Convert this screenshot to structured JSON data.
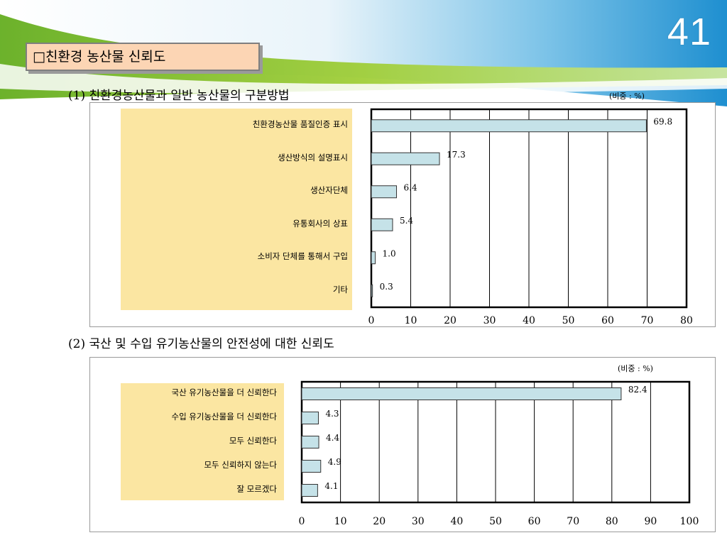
{
  "slide": {
    "number": "41",
    "title": "□친환경 농산물 신뢰도"
  },
  "charts": {
    "chart1": {
      "heading": "(1) 친환경농산물과 일반 농산물의 구분방법",
      "unit": "(비중 : %)"
    },
    "chart2": {
      "heading": "(2) 국산 및 수입 유기농산물의 안전성에 대한 신뢰도",
      "unit": "(비중 : %)"
    }
  },
  "colors": {
    "bar_fill": "#c5e2e8",
    "bar_stroke": "#333333",
    "label_bg": "#fbe6a2",
    "title_bg": "#fcd5b4"
  },
  "chart_data": [
    {
      "type": "bar",
      "orientation": "horizontal",
      "categories": [
        "친환경농산물 품질인증 표시",
        "생산방식의 설명표시",
        "생산자단체",
        "유통회사의 상표",
        "소비자 단체를 통해서 구입",
        "기타"
      ],
      "values": [
        69.8,
        17.3,
        6.4,
        5.4,
        1.0,
        0.3
      ],
      "value_labels": [
        "69.8",
        "17.3",
        "6.4",
        "5.4",
        "1.0",
        "0.3"
      ],
      "xlim": [
        0,
        80
      ],
      "xticks": [
        "0",
        "10",
        "20",
        "30",
        "40",
        "50",
        "60",
        "70",
        "80"
      ],
      "grid": true
    },
    {
      "type": "bar",
      "orientation": "horizontal",
      "categories": [
        "국산 유기농산물을 더 신뢰한다",
        "수입 유기농산물을 더 신뢰한다",
        "모두 신뢰한다",
        "모두 신뢰하지 않는다",
        "잘 모르겠다"
      ],
      "values": [
        82.4,
        4.3,
        4.4,
        4.9,
        4.1
      ],
      "value_labels": [
        "82.4",
        "4.3",
        "4.4",
        "4.9",
        "4.1"
      ],
      "xlim": [
        0,
        100
      ],
      "xticks": [
        "0",
        "10",
        "20",
        "30",
        "40",
        "50",
        "60",
        "70",
        "80",
        "90",
        "100"
      ],
      "grid": true
    }
  ]
}
